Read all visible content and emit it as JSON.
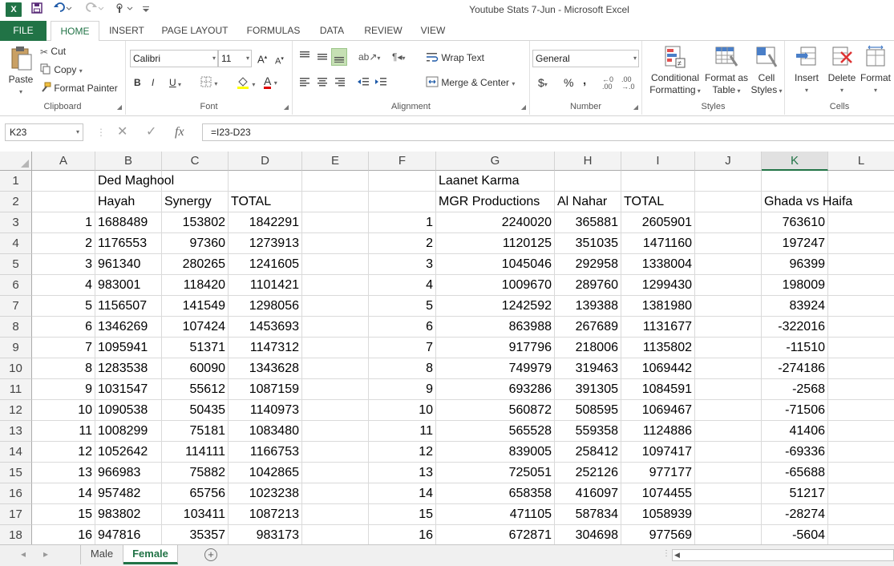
{
  "window": {
    "title": "Youtube Stats 7-Jun - Microsoft Excel",
    "app_icon": "X"
  },
  "quick_access": {
    "icons": [
      "save-icon",
      "undo-icon",
      "redo-icon",
      "touch-mode-icon",
      "customize-icon"
    ]
  },
  "ribbon_tabs": [
    "FILE",
    "HOME",
    "INSERT",
    "PAGE LAYOUT",
    "FORMULAS",
    "DATA",
    "REVIEW",
    "VIEW"
  ],
  "active_tab": "HOME",
  "ribbon": {
    "clipboard": {
      "label": "Clipboard",
      "paste": "Paste",
      "cut": "Cut",
      "copy": "Copy",
      "format_painter": "Format Painter"
    },
    "font": {
      "label": "Font",
      "name": "Calibri",
      "size": "11",
      "bold": "B",
      "italic": "I",
      "underline": "U",
      "font_color": "A"
    },
    "alignment": {
      "label": "Alignment",
      "wrap_text": "Wrap Text",
      "merge_center": "Merge & Center"
    },
    "number": {
      "label": "Number",
      "format": "General",
      "currency": "$",
      "percent": "%",
      "comma": ","
    },
    "styles": {
      "label": "Styles",
      "conditional_formatting_1": "Conditional",
      "conditional_formatting_2": "Formatting",
      "format_as_table_1": "Format as",
      "format_as_table_2": "Table",
      "cell_styles_1": "Cell",
      "cell_styles_2": "Styles"
    },
    "cells": {
      "label": "Cells",
      "insert": "Insert",
      "delete": "Delete",
      "format": "Format"
    }
  },
  "formula_bar": {
    "name_box": "K23",
    "formula": "=I23-D23"
  },
  "columns": [
    "A",
    "B",
    "C",
    "D",
    "E",
    "F",
    "G",
    "H",
    "I",
    "J",
    "K",
    "L"
  ],
  "selected_column": "K",
  "selected_row": "",
  "rows": [
    {
      "n": "1",
      "A": "",
      "B": "Ded Maghool",
      "C": "",
      "D": "",
      "E": "",
      "F": "",
      "G": "Laanet Karma",
      "H": "",
      "I": "",
      "J": "",
      "K": "",
      "L": ""
    },
    {
      "n": "2",
      "A": "",
      "B": "Hayah",
      "C": "Synergy",
      "D": "TOTAL",
      "E": "",
      "F": "",
      "G": "MGR Productions",
      "H": "Al Nahar",
      "I": "TOTAL",
      "J": "",
      "K": "Ghada vs Haifa",
      "L": ""
    },
    {
      "n": "3",
      "A": "1",
      "B": "1688489",
      "C": "153802",
      "D": "1842291",
      "E": "",
      "F": "1",
      "G": "2240020",
      "H": "365881",
      "I": "2605901",
      "J": "",
      "K": "763610",
      "L": ""
    },
    {
      "n": "4",
      "A": "2",
      "B": "1176553",
      "C": "97360",
      "D": "1273913",
      "E": "",
      "F": "2",
      "G": "1120125",
      "H": "351035",
      "I": "1471160",
      "J": "",
      "K": "197247",
      "L": ""
    },
    {
      "n": "5",
      "A": "3",
      "B": "961340",
      "C": "280265",
      "D": "1241605",
      "E": "",
      "F": "3",
      "G": "1045046",
      "H": "292958",
      "I": "1338004",
      "J": "",
      "K": "96399",
      "L": ""
    },
    {
      "n": "6",
      "A": "4",
      "B": "983001",
      "C": "118420",
      "D": "1101421",
      "E": "",
      "F": "4",
      "G": "1009670",
      "H": "289760",
      "I": "1299430",
      "J": "",
      "K": "198009",
      "L": ""
    },
    {
      "n": "7",
      "A": "5",
      "B": "1156507",
      "C": "141549",
      "D": "1298056",
      "E": "",
      "F": "5",
      "G": "1242592",
      "H": "139388",
      "I": "1381980",
      "J": "",
      "K": "83924",
      "L": ""
    },
    {
      "n": "8",
      "A": "6",
      "B": "1346269",
      "C": "107424",
      "D": "1453693",
      "E": "",
      "F": "6",
      "G": "863988",
      "H": "267689",
      "I": "1131677",
      "J": "",
      "K": "-322016",
      "L": ""
    },
    {
      "n": "9",
      "A": "7",
      "B": "1095941",
      "C": "51371",
      "D": "1147312",
      "E": "",
      "F": "7",
      "G": "917796",
      "H": "218006",
      "I": "1135802",
      "J": "",
      "K": "-11510",
      "L": ""
    },
    {
      "n": "10",
      "A": "8",
      "B": "1283538",
      "C": "60090",
      "D": "1343628",
      "E": "",
      "F": "8",
      "G": "749979",
      "H": "319463",
      "I": "1069442",
      "J": "",
      "K": "-274186",
      "L": ""
    },
    {
      "n": "11",
      "A": "9",
      "B": "1031547",
      "C": "55612",
      "D": "1087159",
      "E": "",
      "F": "9",
      "G": "693286",
      "H": "391305",
      "I": "1084591",
      "J": "",
      "K": "-2568",
      "L": ""
    },
    {
      "n": "12",
      "A": "10",
      "B": "1090538",
      "C": "50435",
      "D": "1140973",
      "E": "",
      "F": "10",
      "G": "560872",
      "H": "508595",
      "I": "1069467",
      "J": "",
      "K": "-71506",
      "L": ""
    },
    {
      "n": "13",
      "A": "11",
      "B": "1008299",
      "C": "75181",
      "D": "1083480",
      "E": "",
      "F": "11",
      "G": "565528",
      "H": "559358",
      "I": "1124886",
      "J": "",
      "K": "41406",
      "L": ""
    },
    {
      "n": "14",
      "A": "12",
      "B": "1052642",
      "C": "114111",
      "D": "1166753",
      "E": "",
      "F": "12",
      "G": "839005",
      "H": "258412",
      "I": "1097417",
      "J": "",
      "K": "-69336",
      "L": ""
    },
    {
      "n": "15",
      "A": "13",
      "B": "966983",
      "C": "75882",
      "D": "1042865",
      "E": "",
      "F": "13",
      "G": "725051",
      "H": "252126",
      "I": "977177",
      "J": "",
      "K": "-65688",
      "L": ""
    },
    {
      "n": "16",
      "A": "14",
      "B": "957482",
      "C": "65756",
      "D": "1023238",
      "E": "",
      "F": "14",
      "G": "658358",
      "H": "416097",
      "I": "1074455",
      "J": "",
      "K": "51217",
      "L": ""
    },
    {
      "n": "17",
      "A": "15",
      "B": "983802",
      "C": "103411",
      "D": "1087213",
      "E": "",
      "F": "15",
      "G": "471105",
      "H": "587834",
      "I": "1058939",
      "J": "",
      "K": "-28274",
      "L": ""
    },
    {
      "n": "18",
      "A": "16",
      "B": "947816",
      "C": "35357",
      "D": "983173",
      "E": "",
      "F": "16",
      "G": "672871",
      "H": "304698",
      "I": "977569",
      "J": "",
      "K": "-5604",
      "L": ""
    }
  ],
  "sheets": [
    "Male",
    "Female"
  ],
  "active_sheet": "Female",
  "colors": {
    "accent": "#217346",
    "header_bg": "#f3f3f3",
    "gridline": "#dadada"
  }
}
